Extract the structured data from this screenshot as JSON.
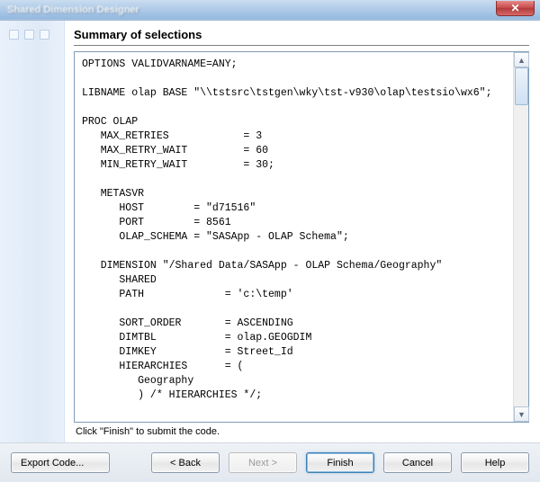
{
  "background": {
    "blurred_title": "Shared Dimension Designer",
    "close_glyph": "✕"
  },
  "title": "Summary of selections",
  "code": "OPTIONS VALIDVARNAME=ANY;\n\nLIBNAME olap BASE \"\\\\tstsrc\\tstgen\\wky\\tst-v930\\olap\\testsio\\wx6\";\n\nPROC OLAP\n   MAX_RETRIES            = 3\n   MAX_RETRY_WAIT         = 60\n   MIN_RETRY_WAIT         = 30;\n\n   METASVR\n      HOST        = \"d71516\"\n      PORT        = 8561\n      OLAP_SCHEMA = \"SASApp - OLAP Schema\";\n\n   DIMENSION \"/Shared Data/SASApp - OLAP Schema/Geography\"\n      SHARED\n      PATH             = 'c:\\temp'\n\n      SORT_ORDER       = ASCENDING\n      DIMTBL           = olap.GEOGDIM\n      DIMKEY           = Street_Id\n      HIERARCHIES      = (\n         Geography\n         ) /* HIERARCHIES */;",
  "hint": "Click \"Finish\" to submit the code.",
  "scroll": {
    "up_glyph": "▲",
    "down_glyph": "▼"
  },
  "buttons": {
    "export": "Export Code...",
    "back": "< Back",
    "next": "Next >",
    "finish": "Finish",
    "cancel": "Cancel",
    "help": "Help"
  }
}
